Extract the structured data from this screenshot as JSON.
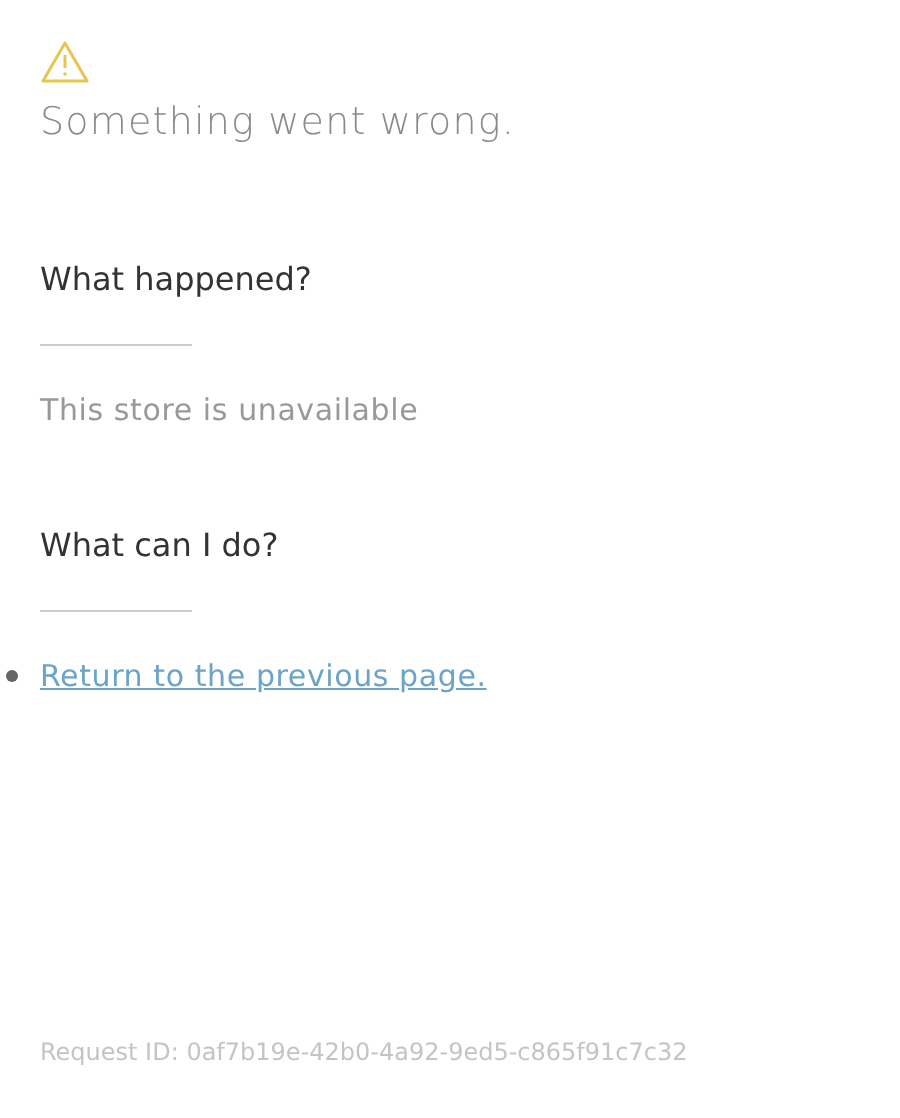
{
  "title": "Something went wrong.",
  "sections": [
    {
      "heading": "What happened?",
      "kind": "text",
      "text": "This store is unavailable"
    },
    {
      "heading": "What can I do?",
      "kind": "links",
      "links": [
        "Return to the previous page."
      ]
    }
  ],
  "request_id": "Request ID: 0af7b19e-42b0-4a92-9ed5-c865f91c7c32"
}
